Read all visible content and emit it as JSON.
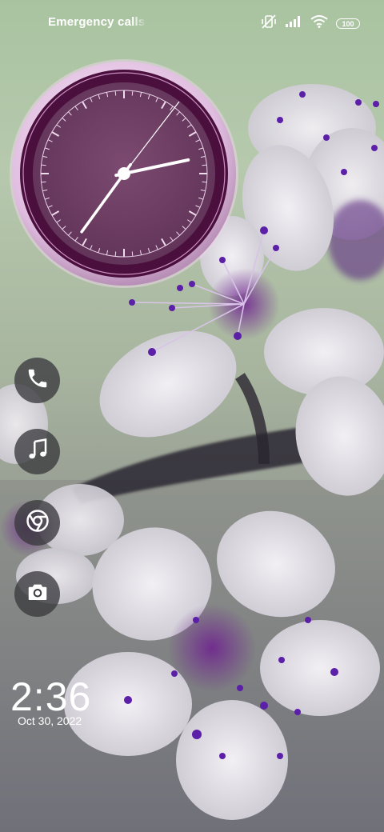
{
  "status_bar": {
    "carrier_text": "Emergency calls only",
    "battery_level": "100",
    "icons": [
      "vibrate-off-icon",
      "signal-icon",
      "wifi-icon",
      "battery-icon"
    ]
  },
  "clock_widget": {
    "type": "analog",
    "hour": 2,
    "minute": 36,
    "colors": {
      "face": "#6b3a5d",
      "ring": "#4a0f3c",
      "bezel": "#e3c4e0"
    }
  },
  "shortcuts": [
    {
      "name": "phone",
      "icon": "phone-icon"
    },
    {
      "name": "music",
      "icon": "music-note-icon"
    },
    {
      "name": "chrome",
      "icon": "chrome-icon"
    },
    {
      "name": "camera",
      "icon": "camera-icon"
    }
  ],
  "lock_clock": {
    "time": "2:36",
    "date": "Oct 30, 2022"
  },
  "colors": {
    "accent": "#7a2e9c",
    "petal": "#e6e2ea",
    "stamen": "#5b1fa8"
  }
}
